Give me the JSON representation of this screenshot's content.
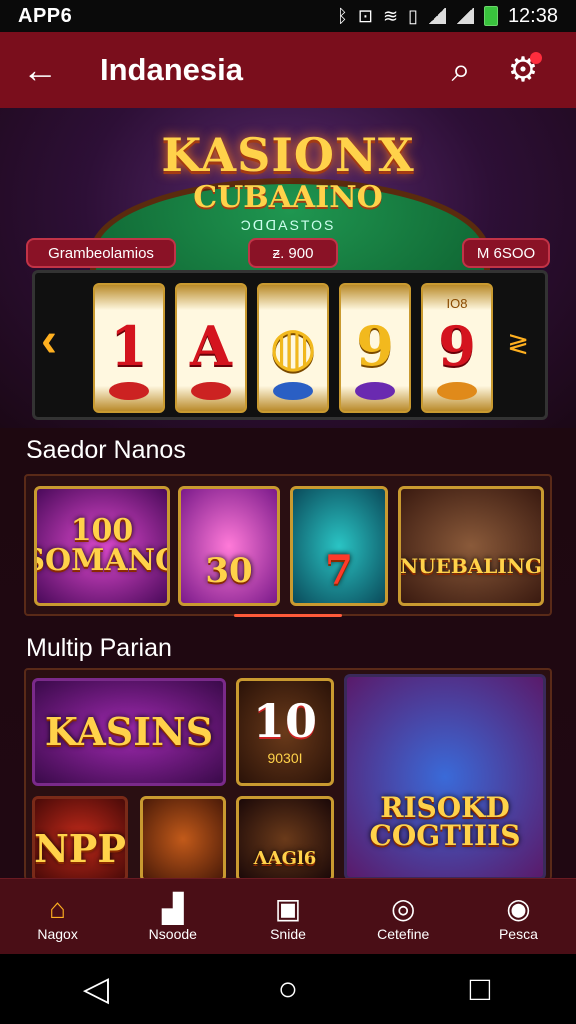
{
  "status_bar": {
    "app_name": "APP6",
    "time": "12:38",
    "icons": [
      "bluetooth-icon",
      "nfc-icon",
      "wifi-icon",
      "vibrate-icon",
      "signal-icon",
      "signal-icon",
      "battery-icon"
    ]
  },
  "top_bar": {
    "title": "Indanesia",
    "back_icon": "←",
    "search_icon": "⌕",
    "settings_icon": "⚙"
  },
  "hero": {
    "logo_line1": "KASIONX",
    "logo_line2": "CUBAAINO",
    "logo_line3": "ƆᗡᗡASTOS",
    "pill_left": "Grambeolamios",
    "pill_center": "ᵶ. 900",
    "pill_right": "M 6SOO"
  },
  "slot": {
    "reels": [
      {
        "symbol": "1",
        "top": ""
      },
      {
        "symbol": "A",
        "top": ""
      },
      {
        "symbol": "◍",
        "top": ""
      },
      {
        "symbol": "9",
        "top": ""
      },
      {
        "symbol": "9",
        "top": "IO8"
      }
    ],
    "left_arrow": "‹",
    "right_arrow": "≷"
  },
  "section1": {
    "title": "Saedor Nanos",
    "tiles": [
      "100\nSOMANG",
      "30",
      "7",
      "NUEBALING"
    ]
  },
  "section2": {
    "title": "Multip Parian",
    "tiles": [
      "KASINS",
      "10",
      "9030I",
      "RISOKD\nCOGTIIIS",
      "NPP",
      "",
      "ΛΑGl6"
    ]
  },
  "bottom_nav": {
    "items": [
      {
        "label": "Nagox",
        "icon": "⌂"
      },
      {
        "label": "Nsoode",
        "icon": "▟"
      },
      {
        "label": "Snide",
        "icon": "▣"
      },
      {
        "label": "Cetefine",
        "icon": "◎"
      },
      {
        "label": "Pesca",
        "icon": "◉"
      }
    ]
  },
  "system_nav": {
    "back": "◁",
    "home": "○",
    "recents": "□"
  },
  "colors": {
    "header": "#7a0e1c",
    "accent": "#ffb020",
    "gold": "#ffd24a"
  }
}
